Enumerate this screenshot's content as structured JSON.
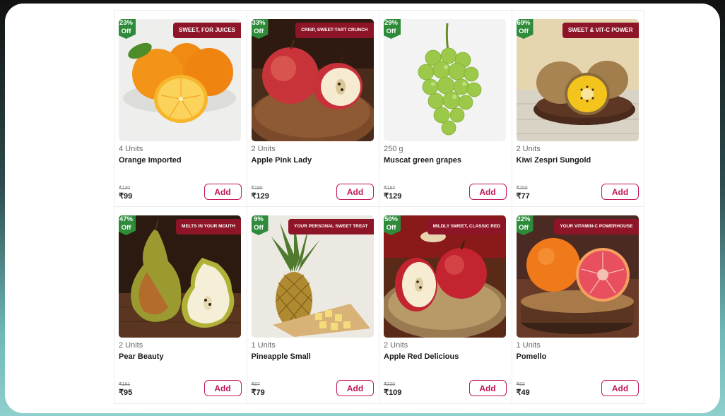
{
  "products": [
    {
      "discount_pct": "23%",
      "discount_off": "Off",
      "tag": "SWEET, FOR JUICES",
      "units": "4 Units",
      "name": "Orange Imported",
      "mrp": "₹130",
      "price": "₹99",
      "add_label": "Add",
      "image": "orange-image"
    },
    {
      "discount_pct": "33%",
      "discount_off": "Off",
      "tag": "CRISP, SWEET-TART CRUNCH",
      "units": "2 Units",
      "name": "Apple Pink Lady",
      "mrp": "₹195",
      "price": "₹129",
      "add_label": "Add",
      "image": "apple-image"
    },
    {
      "discount_pct": "29%",
      "discount_off": "Off",
      "tag": "",
      "units": "250 g",
      "name": "Muscat green grapes",
      "mrp": "₹184",
      "price": "₹129",
      "add_label": "Add",
      "image": "grapes-image"
    },
    {
      "discount_pct": "69%",
      "discount_off": "Off",
      "tag": "SWEET & VIT-C POWER",
      "units": "2 Units",
      "name": "Kiwi Zespri Sungold",
      "mrp": "₹250",
      "price": "₹77",
      "add_label": "Add",
      "image": "kiwi-image"
    },
    {
      "discount_pct": "47%",
      "discount_off": "Off",
      "tag": "MELTS IN YOUR MOUTH",
      "units": "2 Units",
      "name": "Pear Beauty",
      "mrp": "₹181",
      "price": "₹95",
      "add_label": "Add",
      "image": "pear-image"
    },
    {
      "discount_pct": "9%",
      "discount_off": "Off",
      "tag": "YOUR PERSONAL SWEET TREAT",
      "units": "1 Units",
      "name": "Pineapple Small",
      "mrp": "₹87",
      "price": "₹79",
      "add_label": "Add",
      "image": "pineapple-image"
    },
    {
      "discount_pct": "50%",
      "discount_off": "Off",
      "tag": "MILDLY SWEET, CLASSIC RED",
      "units": "2 Units",
      "name": "Apple Red Delicious",
      "mrp": "₹220",
      "price": "₹109",
      "add_label": "Add",
      "image": "red-apple-image"
    },
    {
      "discount_pct": "22%",
      "discount_off": "Off",
      "tag": "YOUR VITAMIN-C POWERHOUSE",
      "units": "1 Units",
      "name": "Pomello",
      "mrp": "₹63",
      "price": "₹49",
      "add_label": "Add",
      "image": "pomello-image"
    }
  ],
  "colors": {
    "discount_badge": "#2e8b3a",
    "tag_background": "#8e1527",
    "add_button": "#c2185b"
  }
}
